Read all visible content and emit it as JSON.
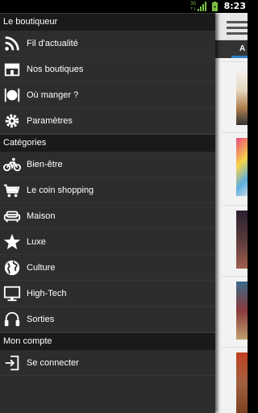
{
  "status_bar": {
    "time": "8:23",
    "network_badge": "3G"
  },
  "drawer": {
    "sections": [
      {
        "header": "Le boutiqueur",
        "items": [
          {
            "label": "Fil d'actualité",
            "icon": "rss-icon"
          },
          {
            "label": "Nos boutiques",
            "icon": "store-icon"
          },
          {
            "label": "Où manger ?",
            "icon": "cutlery-icon"
          },
          {
            "label": "Paramètres",
            "icon": "gear-icon"
          }
        ]
      },
      {
        "header": "Catégories",
        "items": [
          {
            "label": "Bien-être",
            "icon": "bicycle-icon"
          },
          {
            "label": "Le coin shopping",
            "icon": "shopping-cart-icon"
          },
          {
            "label": "Maison",
            "icon": "sofa-icon"
          },
          {
            "label": "Luxe",
            "icon": "star-icon"
          },
          {
            "label": "Culture",
            "icon": "globe-icon"
          },
          {
            "label": "High-Tech",
            "icon": "monitor-icon"
          },
          {
            "label": "Sorties",
            "icon": "headphones-icon"
          }
        ]
      },
      {
        "header": "Mon compte",
        "items": [
          {
            "label": "Se connecter",
            "icon": "login-icon"
          }
        ]
      }
    ]
  },
  "content": {
    "tab_label": "A"
  },
  "colors": {
    "drawer_bg": "#2d2d2d",
    "section_header_bg": "#1a1a1a",
    "tab_accent": "#2f7ec0",
    "battery": "#7cc242"
  }
}
